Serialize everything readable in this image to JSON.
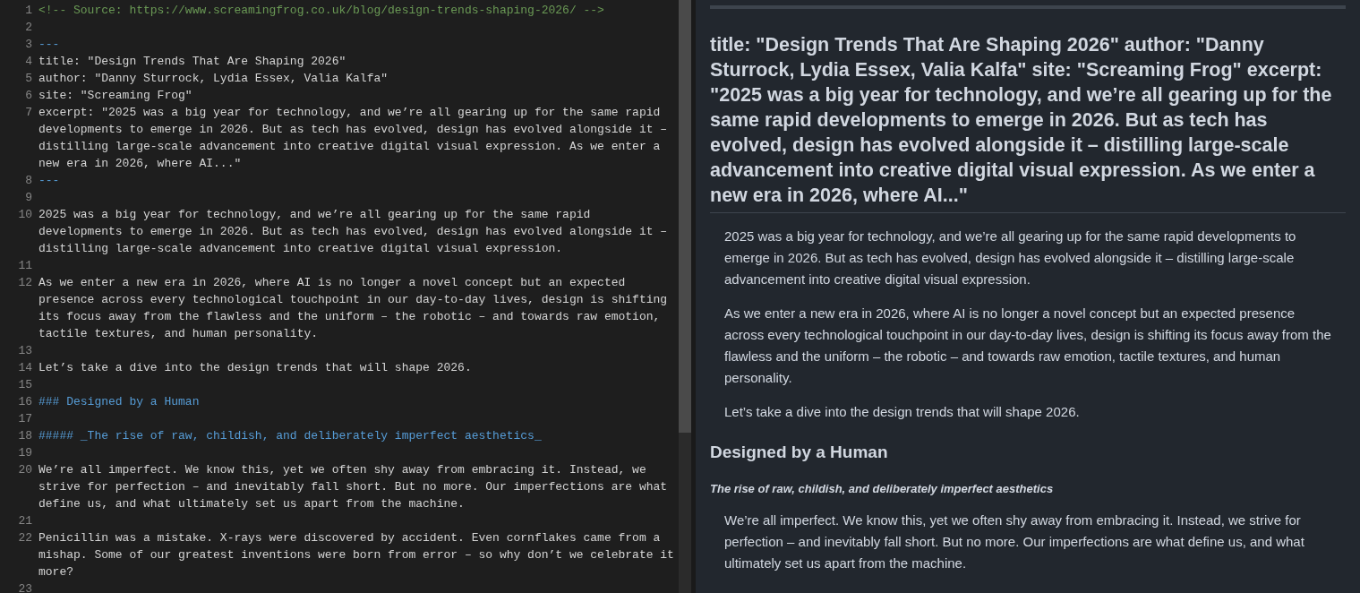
{
  "editor": {
    "lines": [
      {
        "number": "1",
        "kind": "comment",
        "text": "<!-- Source: https://www.screamingfrog.co.uk/blog/design-trends-shaping-2026/ -->"
      },
      {
        "number": "2",
        "kind": "blank"
      },
      {
        "number": "3",
        "kind": "delimiter",
        "text": "---"
      },
      {
        "number": "4",
        "kind": "text",
        "text": "title: \"Design Trends That Are Shaping 2026\""
      },
      {
        "number": "5",
        "kind": "text",
        "text": "author: \"Danny Sturrock, Lydia Essex, Valia Kalfa\""
      },
      {
        "number": "6",
        "kind": "text",
        "text": "site: \"Screaming Frog\""
      },
      {
        "number": "7",
        "kind": "text",
        "text": "excerpt: \"2025 was a big year for technology, and we’re all gearing up for the same rapid developments to emerge in 2026. But as tech has evolved, design has evolved alongside it – distilling large-scale advancement into creative digital visual expression. As we enter a new era in 2026, where AI...\""
      },
      {
        "number": "8",
        "kind": "delimiter",
        "text": "---"
      },
      {
        "number": "9",
        "kind": "blank"
      },
      {
        "number": "10",
        "kind": "text",
        "text": "2025 was a big year for technology, and we’re all gearing up for the same rapid developments to emerge in 2026. But as tech has evolved, design has evolved alongside it – distilling large-scale advancement into creative digital visual expression."
      },
      {
        "number": "11",
        "kind": "blank"
      },
      {
        "number": "12",
        "kind": "text",
        "text": "As we enter a new era in 2026, where AI is no longer a novel concept but an expected presence across every technological touchpoint in our day-to-day lives, design is shifting its focus away from the flawless and the uniform – the robotic – and towards raw emotion, tactile textures, and human personality."
      },
      {
        "number": "13",
        "kind": "blank"
      },
      {
        "number": "14",
        "kind": "text",
        "text": "Let’s take a dive into the design trends that will shape 2026."
      },
      {
        "number": "15",
        "kind": "blank"
      },
      {
        "number": "16",
        "kind": "heading",
        "text": "### Designed by a Human"
      },
      {
        "number": "17",
        "kind": "blank"
      },
      {
        "number": "18",
        "kind": "heading",
        "text": "##### _The rise of raw, childish, and deliberately imperfect aesthetics_"
      },
      {
        "number": "19",
        "kind": "blank"
      },
      {
        "number": "20",
        "kind": "text",
        "text": "We’re all imperfect. We know this, yet we often shy away from embracing it. Instead, we strive for perfection – and inevitably fall short. But no more. Our imperfections are what define us, and what ultimately set us apart from the machine."
      },
      {
        "number": "21",
        "kind": "blank"
      },
      {
        "number": "22",
        "kind": "text",
        "text": "Penicillin was a mistake. X-rays were discovered by accident. Even cornflakes came from a mishap. Some of our greatest inventions were born from error – so why don’t we celebrate it more?"
      },
      {
        "number": "23",
        "kind": "blank"
      }
    ]
  },
  "preview": {
    "blocks": [
      {
        "kind": "rule"
      },
      {
        "kind": "h2",
        "text": "title: \"Design Trends That Are Shaping 2026\" author: \"Danny Sturrock, Lydia Essex, Valia Kalfa\" site: \"Screaming Frog\" excerpt: \"2025 was a big year for technology, and we’re all gearing up for the same rapid developments to emerge in 2026. But as tech has evolved, design has evolved alongside it – distilling large-scale advancement into creative digital visual expression. As we enter a new era in 2026, where AI...\""
      },
      {
        "kind": "p",
        "text": "2025 was a big year for technology, and we’re all gearing up for the same rapid developments to emerge in 2026. But as tech has evolved, design has evolved alongside it – distilling large-scale advancement into creative digital visual expression."
      },
      {
        "kind": "p",
        "text": "As we enter a new era in 2026, where AI is no longer a novel concept but an expected presence across every technological touchpoint in our day-to-day lives, design is shifting its focus away from the flawless and the uniform – the robotic – and towards raw emotion, tactile textures, and human personality."
      },
      {
        "kind": "p",
        "text": "Let’s take a dive into the design trends that will shape 2026."
      },
      {
        "kind": "h3",
        "text": "Designed by a Human"
      },
      {
        "kind": "h5",
        "text": "The rise of raw, childish, and deliberately imperfect aesthetics"
      },
      {
        "kind": "p",
        "text": "We’re all imperfect. We know this, yet we often shy away from embracing it. Instead, we strive for perfection – and inevitably fall short. But no more. Our imperfections are what define us, and what ultimately set us apart from the machine."
      }
    ]
  }
}
